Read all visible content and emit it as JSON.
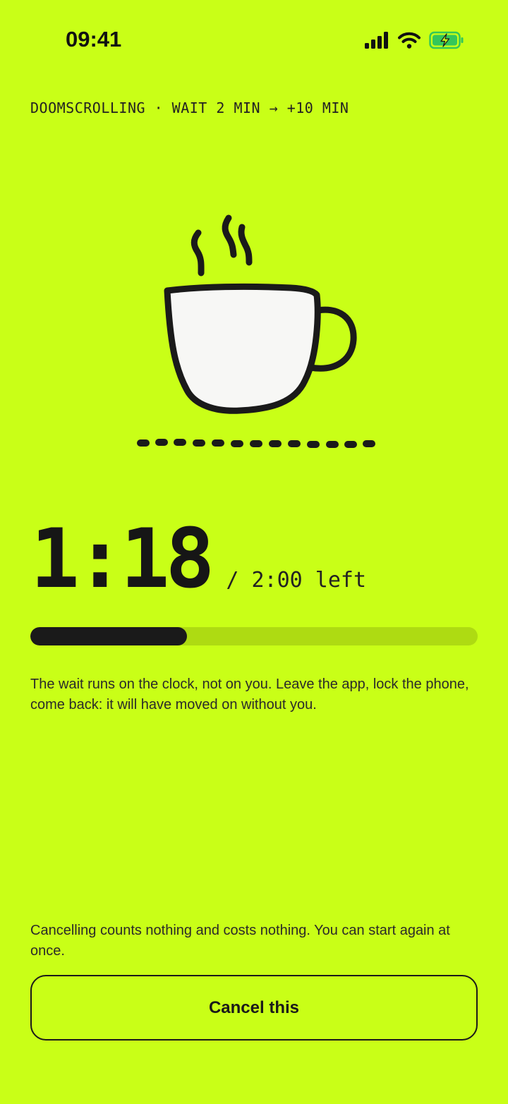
{
  "status_bar": {
    "time": "09:41",
    "icons": [
      "signal-icon",
      "wifi-icon",
      "battery-charging-icon"
    ],
    "battery_color": "#34C759"
  },
  "header": {
    "label": "DOOMSCROLLING · WAIT 2 MIN → +10 MIN"
  },
  "illustration": {
    "icon": "coffee-cup-icon"
  },
  "timer": {
    "remaining": "1:18",
    "total_label": "/ 2:00 left",
    "progress_fraction": 0.35
  },
  "explain_text": "The wait runs on the clock, not on you. Leave the app, lock the phone, come back: it will have moved on without you.",
  "cancel": {
    "note": "Cancelling counts nothing and costs nothing. You can start again at once.",
    "button_label": "Cancel this"
  },
  "colors": {
    "background": "#C9FF17",
    "progress_track": "#AEDB12",
    "ink": "#1A1A1A",
    "cup_fill": "#F7F7F5"
  }
}
